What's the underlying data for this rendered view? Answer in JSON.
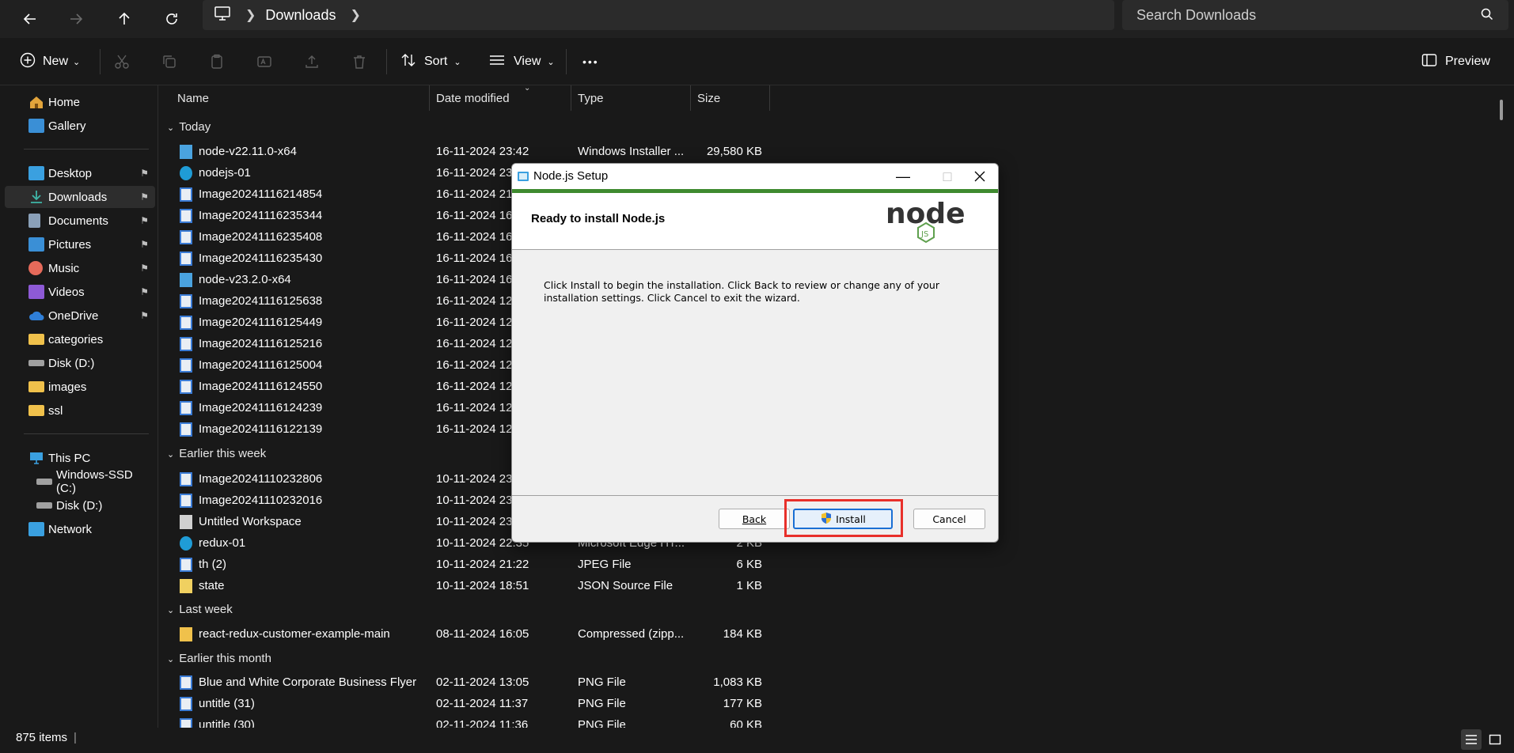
{
  "address_bar": {
    "location": "Downloads",
    "search_placeholder": "Search Downloads"
  },
  "toolbar": {
    "new_label": "New",
    "sort_label": "Sort",
    "view_label": "View",
    "more_label": "•••",
    "preview_label": "Preview"
  },
  "sidebar": {
    "items": [
      {
        "label": "Home",
        "icon": "home-icon",
        "color": "#e2a43b"
      },
      {
        "label": "Gallery",
        "icon": "gallery-icon",
        "color": "#3a8fd6"
      },
      {
        "label": "Desktop",
        "icon": "desktop-icon",
        "color": "#3aa0e0",
        "pinned": true
      },
      {
        "label": "Downloads",
        "icon": "download-icon",
        "color": "#3fb6a8",
        "pinned": true,
        "active": true
      },
      {
        "label": "Documents",
        "icon": "documents-icon",
        "color": "#8aa0b8",
        "pinned": true
      },
      {
        "label": "Pictures",
        "icon": "pictures-icon",
        "color": "#3a8fd6",
        "pinned": true
      },
      {
        "label": "Music",
        "icon": "music-icon",
        "color": "#e66a5a",
        "pinned": true
      },
      {
        "label": "Videos",
        "icon": "videos-icon",
        "color": "#8e5ad6",
        "pinned": true
      },
      {
        "label": "OneDrive",
        "icon": "cloud-icon",
        "color": "#2f7fd8",
        "pinned": true
      },
      {
        "label": "categories",
        "icon": "folder-icon",
        "color": "#f0c14b"
      },
      {
        "label": "Disk (D:)",
        "icon": "drive-icon",
        "color": "#a0a0a0"
      },
      {
        "label": "images",
        "icon": "folder-icon",
        "color": "#f0c14b"
      },
      {
        "label": "ssl",
        "icon": "folder-icon",
        "color": "#f0c14b"
      },
      {
        "label": "This PC",
        "icon": "pc-icon",
        "color": "#3aa0e0"
      },
      {
        "label": "Windows-SSD (C:)",
        "icon": "drive-icon",
        "color": "#a0a0a0"
      },
      {
        "label": "Disk (D:)",
        "icon": "drive-icon",
        "color": "#a0a0a0"
      },
      {
        "label": "Network",
        "icon": "network-icon",
        "color": "#3aa0e0"
      }
    ]
  },
  "columns": {
    "name": "Name",
    "date": "Date modified",
    "type": "Type",
    "size": "Size"
  },
  "groups": {
    "today": "Today",
    "earlier_week": "Earlier this week",
    "last_week": "Last week",
    "earlier_month": "Earlier this month"
  },
  "files": [
    {
      "name": "node-v22.11.0-x64",
      "date": "16-11-2024 23:42",
      "type": "Windows Installer ...",
      "size": "29,580 KB",
      "icon": "installer"
    },
    {
      "name": "nodejs-01",
      "date": "16-11-2024 23:",
      "type": "",
      "size": "",
      "icon": "edge"
    },
    {
      "name": "Image20241116214854",
      "date": "16-11-2024 21",
      "type": "",
      "size": "",
      "icon": "image"
    },
    {
      "name": "Image20241116235344",
      "date": "16-11-2024 16",
      "type": "",
      "size": "",
      "icon": "image"
    },
    {
      "name": "Image20241116235408",
      "date": "16-11-2024 16",
      "type": "",
      "size": "",
      "icon": "image"
    },
    {
      "name": "Image20241116235430",
      "date": "16-11-2024 16",
      "type": "",
      "size": "",
      "icon": "image"
    },
    {
      "name": "node-v23.2.0-x64",
      "date": "16-11-2024 16",
      "type": "",
      "size": "",
      "icon": "installer"
    },
    {
      "name": "Image20241116125638",
      "date": "16-11-2024 12",
      "type": "",
      "size": "",
      "icon": "image"
    },
    {
      "name": "Image20241116125449",
      "date": "16-11-2024 12",
      "type": "",
      "size": "",
      "icon": "image"
    },
    {
      "name": "Image20241116125216",
      "date": "16-11-2024 12",
      "type": "",
      "size": "",
      "icon": "image"
    },
    {
      "name": "Image20241116125004",
      "date": "16-11-2024 12",
      "type": "",
      "size": "",
      "icon": "image"
    },
    {
      "name": "Image20241116124550",
      "date": "16-11-2024 12",
      "type": "",
      "size": "",
      "icon": "image"
    },
    {
      "name": "Image20241116124239",
      "date": "16-11-2024 12",
      "type": "",
      "size": "",
      "icon": "image"
    },
    {
      "name": "Image20241116122139",
      "date": "16-11-2024 12",
      "type": "",
      "size": "",
      "icon": "image"
    },
    {
      "name": "Image20241110232806",
      "date": "10-11-2024 23",
      "type": "",
      "size": "",
      "icon": "image"
    },
    {
      "name": "Image20241110232016",
      "date": "10-11-2024 23",
      "type": "",
      "size": "",
      "icon": "image"
    },
    {
      "name": "Untitled Workspace",
      "date": "10-11-2024 23",
      "type": "",
      "size": "",
      "icon": "file"
    },
    {
      "name": "redux-01",
      "date": "10-11-2024 22:35",
      "type": "Microsoft Edge HT...",
      "size": "2 KB",
      "icon": "edge"
    },
    {
      "name": "th (2)",
      "date": "10-11-2024 21:22",
      "type": "JPEG File",
      "size": "6 KB",
      "icon": "image"
    },
    {
      "name": "state",
      "date": "10-11-2024 18:51",
      "type": "JSON Source File",
      "size": "1 KB",
      "icon": "json"
    },
    {
      "name": "react-redux-customer-example-main",
      "date": "08-11-2024 16:05",
      "type": "Compressed (zipp...",
      "size": "184 KB",
      "icon": "zip"
    },
    {
      "name": "Blue and White Corporate Business Flyer",
      "date": "02-11-2024 13:05",
      "type": "PNG File",
      "size": "1,083 KB",
      "icon": "image"
    },
    {
      "name": "untitle (31)",
      "date": "02-11-2024 11:37",
      "type": "PNG File",
      "size": "177 KB",
      "icon": "image"
    },
    {
      "name": "untitle (30)",
      "date": "02-11-2024 11:36",
      "type": "PNG File",
      "size": "60 KB",
      "icon": "image"
    }
  ],
  "status": {
    "item_count": "875 items"
  },
  "dialog": {
    "title": "Node.js Setup",
    "heading": "Ready to install Node.js",
    "body": "Click Install to begin the installation. Click Back to review or change any of your installation settings. Click Cancel to exit the wizard.",
    "back_label": "Back",
    "install_label": "Install",
    "cancel_label": "Cancel",
    "accent_color": "#3f8a2f"
  }
}
